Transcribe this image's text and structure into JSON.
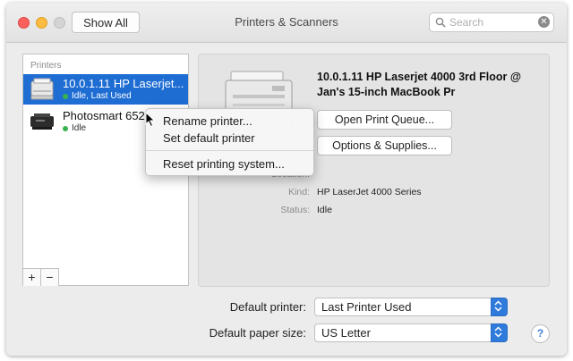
{
  "window": {
    "title": "Printers & Scanners",
    "show_all_label": "Show All",
    "search_placeholder": "Search"
  },
  "printers_list": {
    "header": "Printers",
    "items": [
      {
        "name": "10.0.1.11 HP Laserjet...",
        "status": "Idle, Last Used",
        "selected": true
      },
      {
        "name": "Photosmart 6520",
        "status": "Idle",
        "selected": false
      }
    ],
    "add_label": "+",
    "remove_label": "−"
  },
  "context_menu": {
    "items": [
      "Rename printer...",
      "Set default printer",
      "Reset printing system..."
    ]
  },
  "detail": {
    "printer_name": "10.0.1.11 HP Laserjet 4000 3rd Floor @ Jan's 15-inch MacBook Pr",
    "open_queue_label": "Open Print Queue...",
    "options_label": "Options & Supplies...",
    "location_label": "Location:",
    "kind_label": "Kind:",
    "kind_value": "HP LaserJet 4000 Series",
    "status_label": "Status:",
    "status_value": "Idle"
  },
  "footer": {
    "default_printer_label": "Default printer:",
    "default_printer_value": "Last Printer Used",
    "paper_size_label": "Default paper size:",
    "paper_size_value": "US Letter",
    "help_label": "?"
  },
  "colors": {
    "selection": "#1e6dd3",
    "accent": "#2f7bdc",
    "status_dot": "#37b24d"
  }
}
